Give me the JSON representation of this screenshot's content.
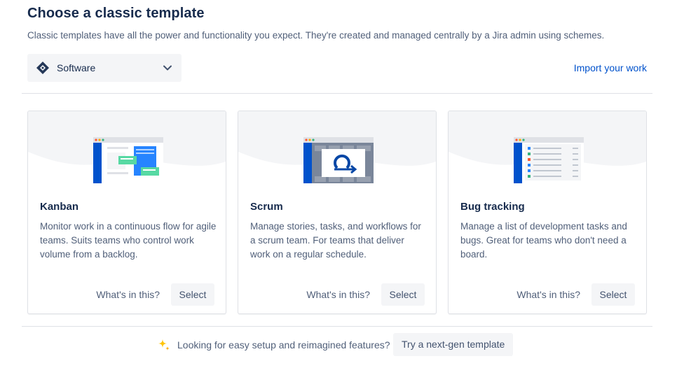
{
  "header": {
    "title": "Choose a classic template",
    "subtitle": "Classic templates have all the power and functionality you expect. They're created and managed centrally by a Jira admin using schemes."
  },
  "type_select": {
    "value": "Software",
    "icon": "jira-software-icon"
  },
  "import_link": "Import your work",
  "cards": [
    {
      "title": "Kanban",
      "description": "Monitor work in a continuous flow for agile teams. Suits teams who control work volume from a backlog.",
      "whats_label": "What's in this?",
      "select_label": "Select",
      "illustration": "kanban-board-illustration"
    },
    {
      "title": "Scrum",
      "description": "Manage stories, tasks, and workflows for a scrum team. For teams that deliver work on a regular schedule.",
      "whats_label": "What's in this?",
      "select_label": "Select",
      "illustration": "scrum-sprint-illustration"
    },
    {
      "title": "Bug tracking",
      "description": "Manage a list of development tasks and bugs. Great for teams who don't need a board.",
      "whats_label": "What's in this?",
      "select_label": "Select",
      "illustration": "bug-list-illustration"
    }
  ],
  "footer": {
    "text": "Looking for easy setup and reimagined features?",
    "button_label": "Try a next-gen template",
    "icon": "sparkle-icon"
  },
  "colors": {
    "link": "#0052cc",
    "heading": "#172b4d",
    "body_text": "#505f79",
    "button_bg": "#f4f5f7",
    "illustration_blue": "#0052cc",
    "sparkle": "#ffc400"
  }
}
